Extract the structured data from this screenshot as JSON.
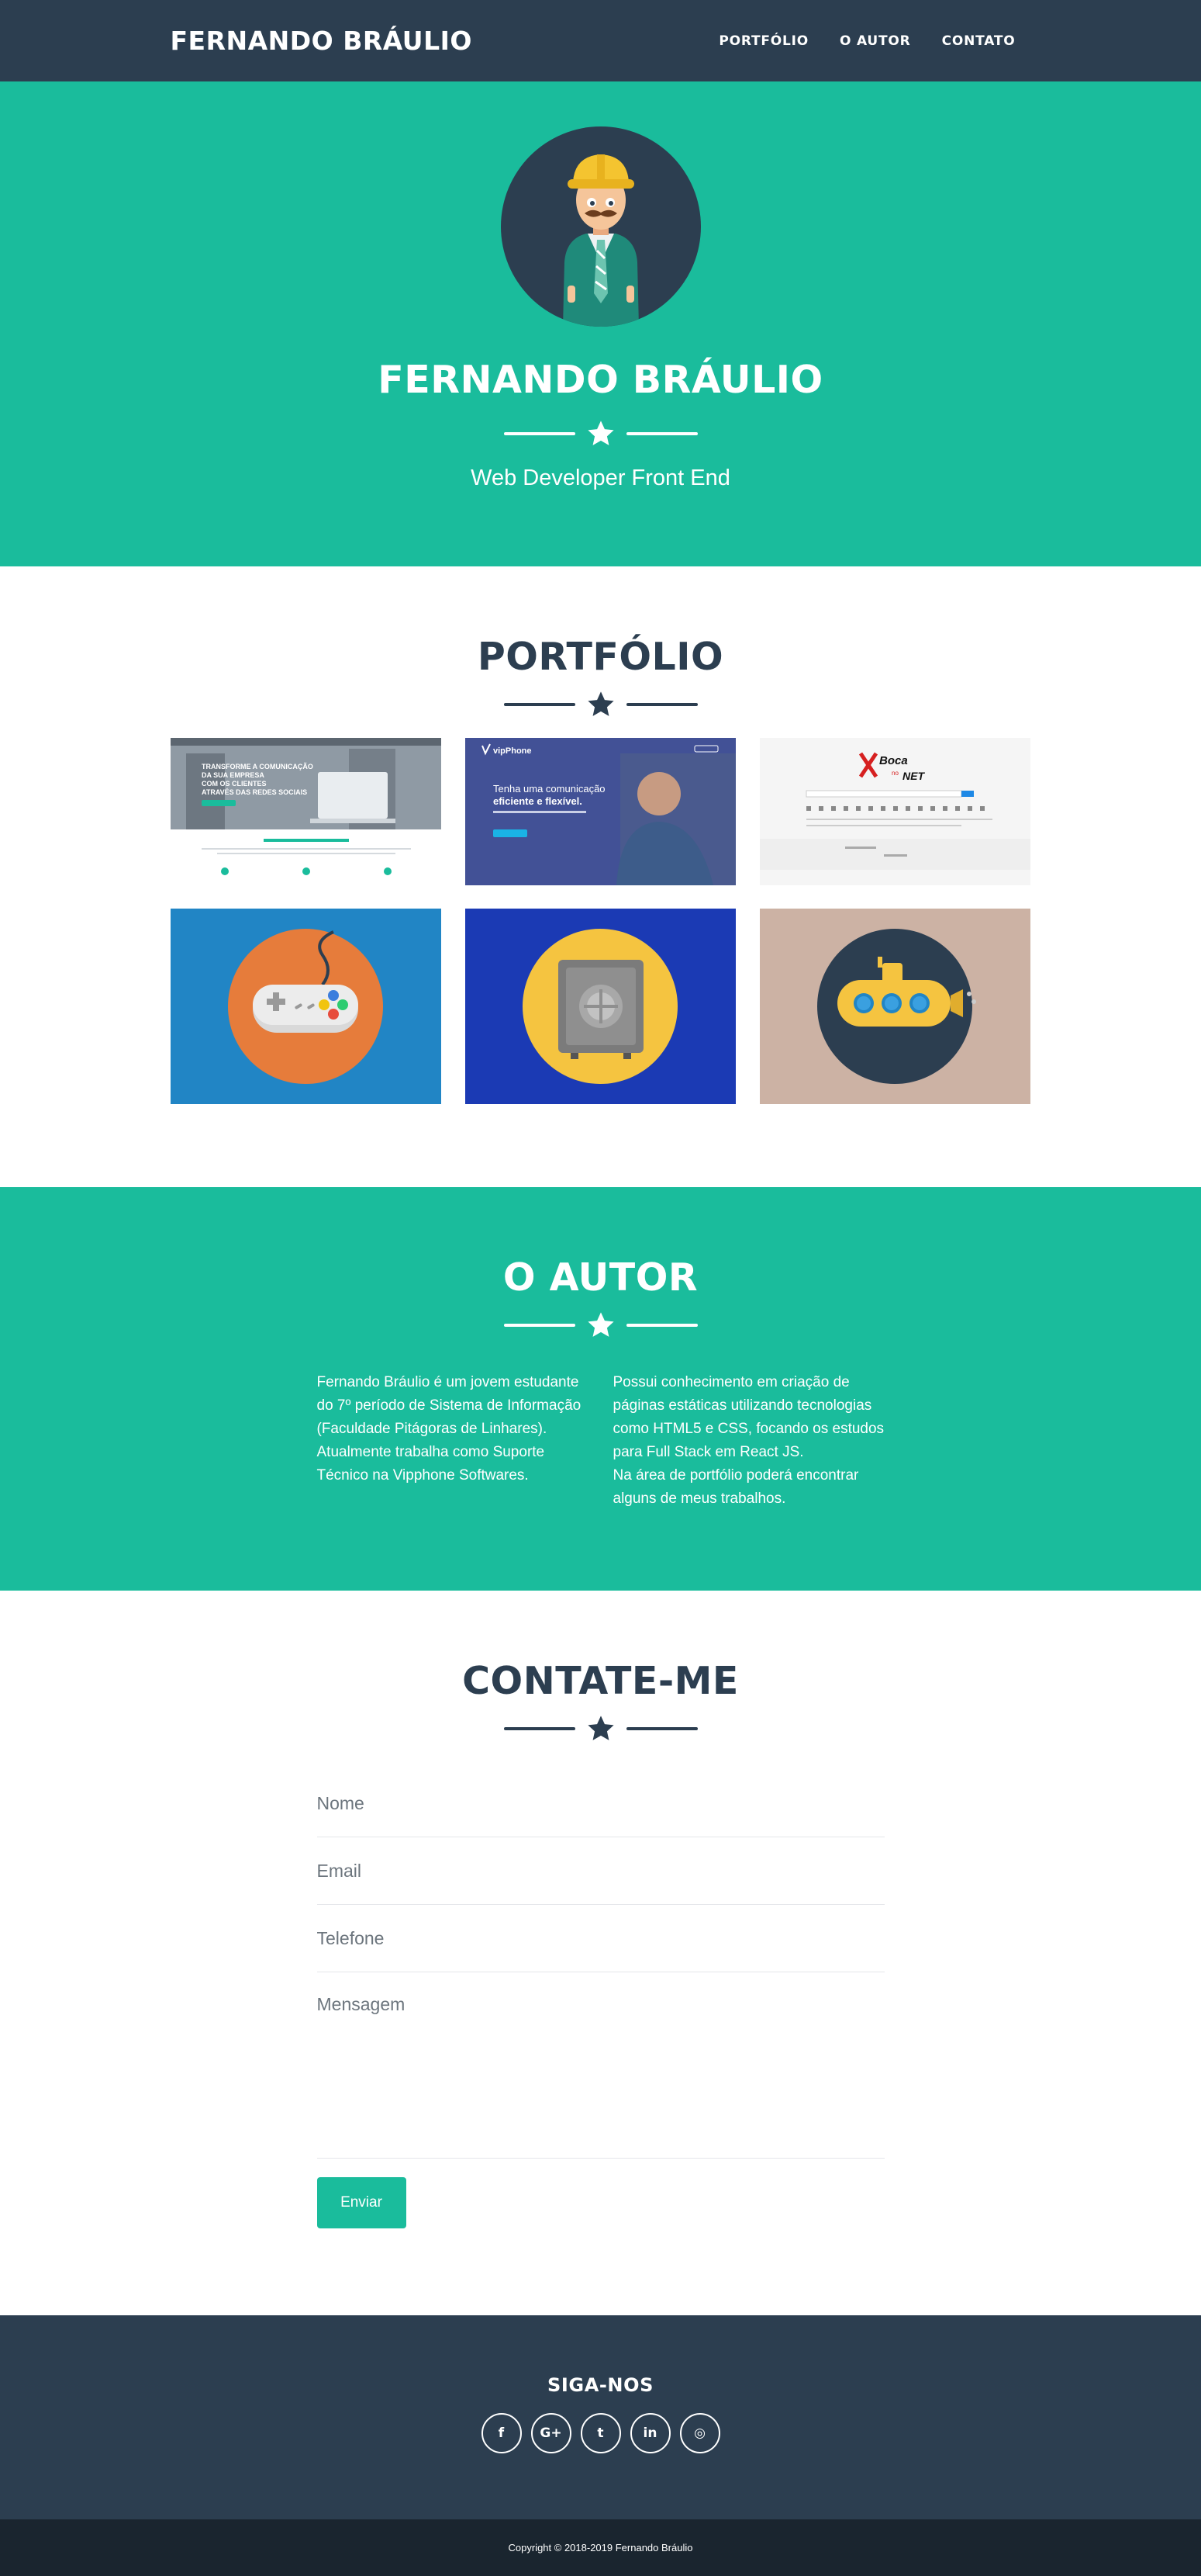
{
  "nav": {
    "brand": "FERNANDO BRÁULIO",
    "links": [
      "PORTFÓLIO",
      "O AUTOR",
      "CONTATO"
    ]
  },
  "header": {
    "title": "FERNANDO BRÁULIO",
    "subtitle": "Web Developer Front End"
  },
  "portfolio": {
    "title": "PORTFÓLIO",
    "items": [
      {
        "name": "screenshot-website-1",
        "text": [
          "TRANSFORME A COMUNICAÇÃO",
          "DA SUA EMPRESA",
          "COM OS CLIENTES",
          "ATRAVÉS DAS REDES SOCIAIS"
        ]
      },
      {
        "name": "screenshot-vipphone",
        "logo": "vipPhone",
        "text": [
          "Tenha uma comunicação",
          "eficiente e flexível."
        ]
      },
      {
        "name": "screenshot-boca-no-net",
        "logo": [
          "Boca",
          "no",
          "NET"
        ]
      },
      {
        "name": "game-controller-icon"
      },
      {
        "name": "safe-icon"
      },
      {
        "name": "submarine-icon"
      }
    ]
  },
  "about": {
    "title": "O AUTOR",
    "left": "Fernando Bráulio é um jovem estudante do 7º período de Sistema de Informação (Faculdade Pitágoras de Linhares). Atualmente trabalha como Suporte Técnico na Vipphone Softwares.",
    "right_line1": "Possui conhecimento em criação de páginas estáticas utilizando tecnologias como HTML5 e CSS, focando os estudos para Full Stack em React JS.",
    "right_line2": "Na área de portfólio poderá encontrar alguns de meus trabalhos."
  },
  "contact": {
    "title": "CONTATE-ME",
    "placeholders": {
      "name": "Nome",
      "email": "Email",
      "phone": "Telefone",
      "message": "Mensagem"
    },
    "submit": "Enviar"
  },
  "footer": {
    "title": "SIGA-NOS",
    "socials": [
      {
        "name": "facebook-icon",
        "glyph": "f"
      },
      {
        "name": "google-plus-icon",
        "glyph": "G+"
      },
      {
        "name": "twitter-icon",
        "glyph": "t"
      },
      {
        "name": "linkedin-icon",
        "glyph": "in"
      },
      {
        "name": "dribbble-icon",
        "glyph": "◎"
      }
    ],
    "copyright": "Copyright © 2018-2019 Fernando Bráulio"
  },
  "colors": {
    "primary": "#2c3e50",
    "accent": "#1abc9c",
    "footer_bottom": "#1a252f"
  }
}
